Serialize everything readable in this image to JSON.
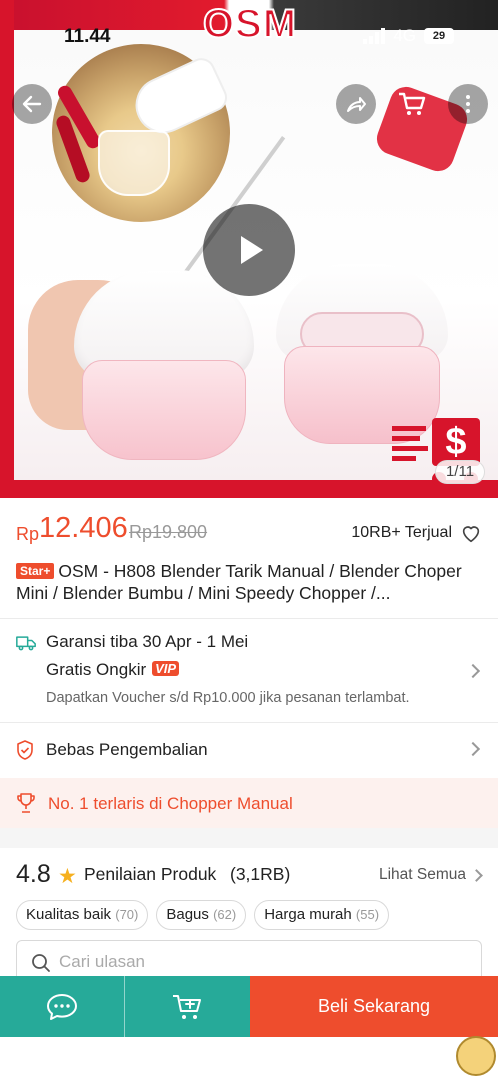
{
  "status_bar": {
    "time": "11.44",
    "network": "4G",
    "battery": "29"
  },
  "hero": {
    "brand_logo": "OSM",
    "page_counter": "1/11",
    "promo_sticker_symbol": "$"
  },
  "price": {
    "currency": "Rp",
    "current": "12.406",
    "original": "Rp19.800",
    "sold": "10RB+ Terjual"
  },
  "product": {
    "badge": "Star+",
    "title": "OSM - H808 Blender Tarik Manual / Blender Choper Mini / Blender Bumbu / Mini Speedy Chopper /..."
  },
  "shipping": {
    "guarantee": "Garansi tiba 30 Apr - 1 Mei",
    "free_shipping": "Gratis Ongkir",
    "vip_badge": "VIP",
    "voucher_note": "Dapatkan Voucher s/d Rp10.000 jika pesanan terlambat."
  },
  "returns": {
    "label": "Bebas Pengembalian"
  },
  "best_seller": {
    "label": "No. 1 terlaris di Chopper Manual"
  },
  "rating": {
    "score": "4.8",
    "star": "★",
    "label": "Penilaian Produk",
    "count": "(3,1RB)",
    "see_all": "Lihat Semua",
    "chips": [
      {
        "label": "Kualitas baik",
        "count": "(70)"
      },
      {
        "label": "Bagus",
        "count": "(62)"
      },
      {
        "label": "Harga murah",
        "count": "(55)"
      }
    ]
  },
  "review_search": {
    "placeholder": "Cari ulasan"
  },
  "bottom_bar": {
    "buy_label": "Beli Sekarang"
  },
  "colors": {
    "accent": "#ee4d2d",
    "teal": "#26aa99",
    "brand_red": "#d7142b",
    "star": "#f6b01e"
  },
  "icons": {
    "back": "back-arrow-icon",
    "share": "share-icon",
    "cart": "cart-icon",
    "more": "more-vertical-icon",
    "play": "play-icon",
    "heart": "heart-icon",
    "truck": "truck-icon",
    "shield": "shield-icon",
    "trophy": "trophy-icon",
    "search": "search-icon",
    "chat": "chat-icon",
    "add_cart": "add-to-cart-icon"
  }
}
